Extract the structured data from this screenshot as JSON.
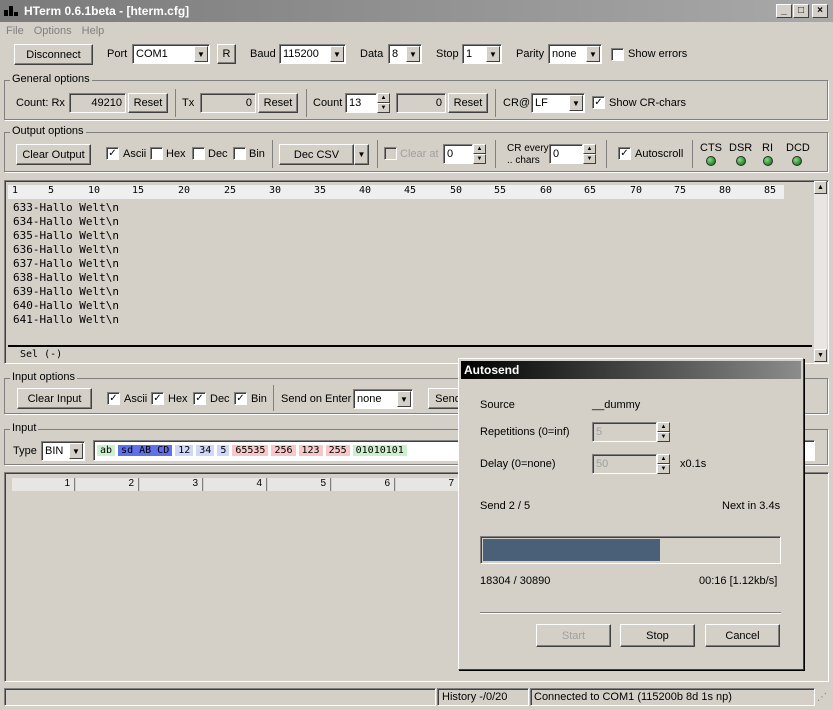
{
  "window": {
    "title": "HTerm 0.6.1beta - [hterm.cfg]",
    "min": "_",
    "max": "□",
    "close": "×"
  },
  "menu": [
    "File",
    "Options",
    "Help"
  ],
  "connection": {
    "disconnect": "Disconnect",
    "port_label": "Port",
    "port": "COM1",
    "r_button": "R",
    "baud_label": "Baud",
    "baud": "115200",
    "data_label": "Data",
    "data": "8",
    "stop_label": "Stop",
    "stop": "1",
    "parity_label": "Parity",
    "parity": "none",
    "show_errors": "Show errors"
  },
  "general": {
    "title": "General options",
    "count_rx_label": "Count: Rx",
    "rx": "49210",
    "reset": "Reset",
    "tx_label": "Tx",
    "tx": "0",
    "count_label": "Count",
    "count": "13",
    "count2": "0",
    "cr_label": "CR@",
    "cr": "LF",
    "show_cr": "Show CR-chars"
  },
  "output": {
    "title": "Output options",
    "clear": "Clear Output",
    "ascii": "Ascii",
    "hex": "Hex",
    "dec": "Dec",
    "bin": "Bin",
    "csv": "Dec CSV",
    "clear_at": "Clear at",
    "clear_at_val": "0",
    "cr_every": "CR every",
    "chars": ".. chars",
    "cr_every_val": "0",
    "autoscroll": "Autoscroll",
    "leds": [
      "CTS",
      "DSR",
      "RI",
      "DCD"
    ]
  },
  "terminal": {
    "ruler": [
      "1",
      "5",
      "10",
      "15",
      "20",
      "25",
      "30",
      "35",
      "40",
      "45",
      "50",
      "55",
      "60",
      "65",
      "70",
      "75",
      "80",
      "85"
    ],
    "lines": [
      "633-Hallo Welt\\n",
      "634-Hallo Welt\\n",
      "635-Hallo Welt\\n",
      "636-Hallo Welt\\n",
      "637-Hallo Welt\\n",
      "638-Hallo Welt\\n",
      "639-Hallo Welt\\n",
      "640-Hallo Welt\\n",
      "641-Hallo Welt\\n"
    ],
    "sel": "Sel (-)"
  },
  "input_options": {
    "title": "Input options",
    "clear": "Clear Input",
    "ascii": "Ascii",
    "hex": "Hex",
    "dec": "Dec",
    "bin": "Bin",
    "send_on_enter": "Send on Enter",
    "send_on_enter_val": "none",
    "send": "Send"
  },
  "input": {
    "title": "Input",
    "type_label": "Type",
    "type": "BIN",
    "tokens": [
      {
        "text": "ab",
        "color": "#ccf0cc"
      },
      {
        "text": "sd AB CD",
        "color": "#6070e8",
        "fg": "#000"
      },
      {
        "text": "12",
        "color": "#cfd8f8"
      },
      {
        "text": "34",
        "color": "#cfd8f8"
      },
      {
        "text": "5",
        "color": "#cfd8f8"
      },
      {
        "text": "65535",
        "color": "#f8c8c8"
      },
      {
        "text": "256",
        "color": "#f8c8c8"
      },
      {
        "text": "123",
        "color": "#f8c8c8"
      },
      {
        "text": "255",
        "color": "#f8c8c8"
      },
      {
        "text": "01010101",
        "color": "#ccf0cc"
      }
    ]
  },
  "grid": {
    "cols": [
      "1",
      "2",
      "3",
      "4",
      "5",
      "6",
      "7"
    ]
  },
  "status": {
    "history": "History -/0/20",
    "connected": "Connected to COM1  (115200b 8d 1s np)"
  },
  "autosend": {
    "title": "Autosend",
    "source_label": "Source",
    "source": "__dummy",
    "reps_label": "Repetitions (0=inf)",
    "reps": "5",
    "delay_label": "Delay (0=none)",
    "delay": "50",
    "delay_unit": "x0.1s",
    "send_progress": "Send 2 / 5",
    "next": "Next in 3.4s",
    "progress": 0.6,
    "bytes": "18304 / 30890",
    "time": "00:16 [1.12kb/s]",
    "start": "Start",
    "stop": "Stop",
    "cancel": "Cancel"
  }
}
